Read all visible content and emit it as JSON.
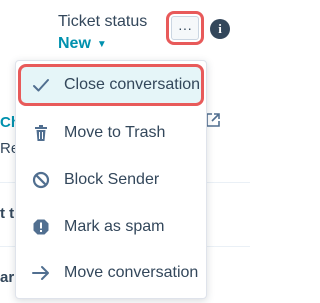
{
  "ticket": {
    "status_label": "Ticket status",
    "status_value": "New",
    "more_label": "···",
    "info_label": "i"
  },
  "background": {
    "fragment_ch": "Ch",
    "fragment_re": "Re",
    "fragment_t": "t th",
    "fragment_ar": "ar"
  },
  "menu": {
    "items": [
      {
        "label": "Close conversation",
        "icon": "check-icon"
      },
      {
        "label": "Move to Trash",
        "icon": "trash-icon"
      },
      {
        "label": "Block Sender",
        "icon": "block-icon"
      },
      {
        "label": "Mark as spam",
        "icon": "spam-icon"
      },
      {
        "label": "Move conversation",
        "icon": "arrow-right-icon"
      }
    ]
  },
  "colors": {
    "accent": "#0091ae",
    "highlight_border": "#e85a5a",
    "highlight_fill": "#e5f5f8",
    "text": "#33475b"
  }
}
